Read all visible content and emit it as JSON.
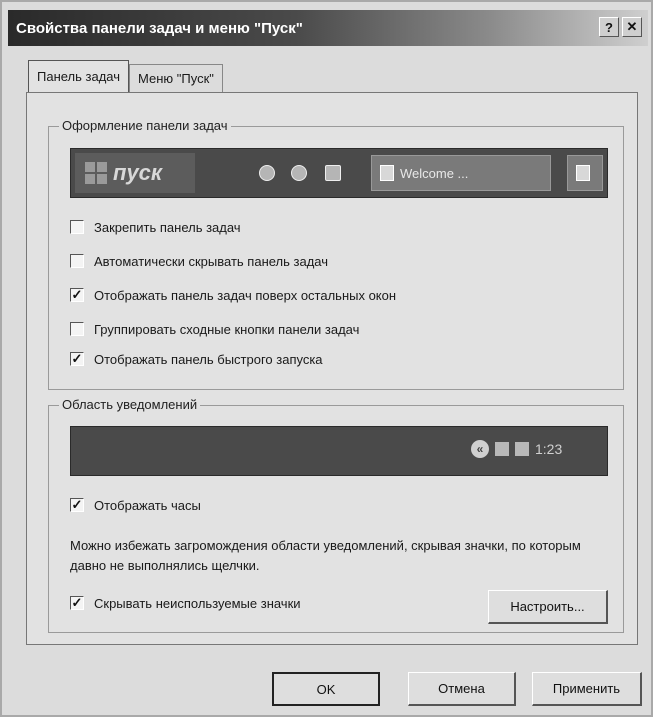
{
  "window": {
    "title": "Свойства панели задач и меню \"Пуск\"",
    "help_label": "?",
    "close_label": "✕"
  },
  "tabs": [
    {
      "label": "Панель задач",
      "active": true
    },
    {
      "label": "Меню \"Пуск\"",
      "active": false
    }
  ],
  "taskbar_group": {
    "title": "Оформление панели задач",
    "preview": {
      "start_label": "пуск",
      "task_button_label": "Welcome ..."
    },
    "options": [
      {
        "label": "Закрепить панель задач",
        "checked": false
      },
      {
        "label": "Автоматически скрывать панель задач",
        "checked": false
      },
      {
        "label": "Отображать панель задач поверх остальных окон",
        "checked": true
      },
      {
        "label": "Группировать сходные кнопки панели задач",
        "checked": false
      },
      {
        "label": "Отображать панель быстрого запуска",
        "checked": true
      }
    ]
  },
  "notify_group": {
    "title": "Область уведомлений",
    "clock_text": "1:23",
    "show_clock": {
      "label": "Отображать часы",
      "checked": true
    },
    "description": "Можно избежать загромождения области уведомлений, скрывая значки, по которым давно не выполнялись щелчки.",
    "hide_icons": {
      "label": "Скрывать неиспользуемые значки",
      "checked": true
    },
    "customize_label": "Настроить..."
  },
  "buttons": {
    "ok_label": "OK",
    "cancel_label": "Отмена",
    "apply_label": "Применить"
  },
  "check_glyph": "✓",
  "icons": [
    "windows-flag-icon",
    "quick-launch-icon",
    "document-icon",
    "chevron-left-icon",
    "tray-icon"
  ]
}
